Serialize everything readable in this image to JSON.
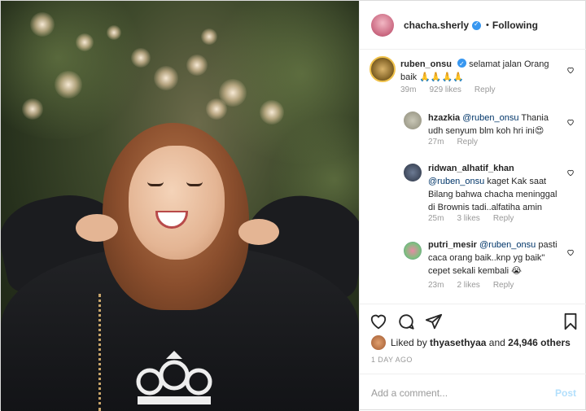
{
  "header": {
    "username": "chacha.sherly",
    "separator": "•",
    "follow_state": "Following"
  },
  "comments": [
    {
      "username": "ruben_onsu",
      "verified": true,
      "text": "selamat jalan Orang baik 🙏🙏🙏🙏",
      "time": "39m",
      "likes": "929 likes",
      "reply": "Reply"
    },
    {
      "username": "hzazkia",
      "mention": "@ruben_onsu",
      "text": "Thania udh senyum blm koh hri ini😍",
      "time": "27m",
      "reply": "Reply"
    },
    {
      "username": "ridwan_alhatif_khan",
      "mention": "@ruben_onsu",
      "text": "kaget Kak saat Bilang bahwa chacha meninggal di Brownis tadi..alfatiha amin",
      "time": "25m",
      "likes": "3 likes",
      "reply": "Reply"
    },
    {
      "username": "putri_mesir",
      "mention": "@ruben_onsu",
      "text": "pasti caca orang baik..knp yg baik\" cepet sekali kembali 😭",
      "time": "23m",
      "likes": "2 likes",
      "reply": "Reply"
    }
  ],
  "likes_line": {
    "prefix": "Liked by",
    "user": "thyasethyaa",
    "and": "and",
    "others": "24,946 others"
  },
  "date": "1 DAY AGO",
  "add_comment": {
    "placeholder": "Add a comment...",
    "post_label": "Post"
  },
  "colors": {
    "verified": "#3897f0",
    "mention": "#003569",
    "muted": "#999999",
    "post_disabled": "#b2dffc"
  }
}
